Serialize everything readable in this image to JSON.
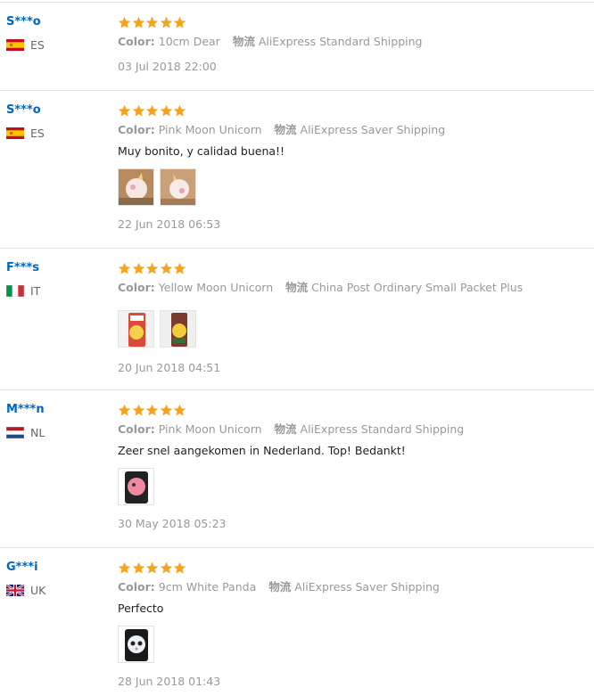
{
  "labels": {
    "color": "Color:",
    "logistics": "物流"
  },
  "reviews": [
    {
      "user": "S***o",
      "country": "ES",
      "flag": "es-flag-icon",
      "color": "10cm Dear",
      "shipping": "AliExpress Standard Shipping",
      "text": "",
      "date": "03 Jul 2018 22:00",
      "rating": 5,
      "photos": []
    },
    {
      "user": "S***o",
      "country": "ES",
      "flag": "es-flag-icon",
      "color": "Pink Moon Unicorn",
      "shipping": "AliExpress Saver Shipping",
      "text": "Muy bonito, y calidad buena!!",
      "date": "22 Jun 2018 06:53",
      "rating": 5,
      "photos": [
        "unicorn-photo-1",
        "unicorn-photo-2"
      ]
    },
    {
      "user": "F***s",
      "country": "IT",
      "flag": "it-flag-icon",
      "color": "Yellow Moon Unicorn",
      "shipping": "China Post Ordinary Small Packet Plus",
      "text": "",
      "date": "20 Jun 2018 04:51",
      "rating": 5,
      "photos": [
        "packaged-unicorn-photo-1",
        "packaged-unicorn-photo-2"
      ]
    },
    {
      "user": "M***n",
      "country": "NL",
      "flag": "nl-flag-icon",
      "color": "Pink Moon Unicorn",
      "shipping": "AliExpress Standard Shipping",
      "text": "Zeer snel aangekomen in Nederland. Top! Bedankt!",
      "date": "30 May 2018 05:23",
      "rating": 5,
      "photos": [
        "pink-unicorn-photo"
      ]
    },
    {
      "user": "G***i",
      "country": "UK",
      "flag": "uk-flag-icon",
      "color": "9cm White Panda",
      "shipping": "AliExpress Saver Shipping",
      "text": "Perfecto",
      "date": "28 Jun 2018 01:43",
      "rating": 5,
      "photos": [
        "panda-photo"
      ]
    }
  ]
}
